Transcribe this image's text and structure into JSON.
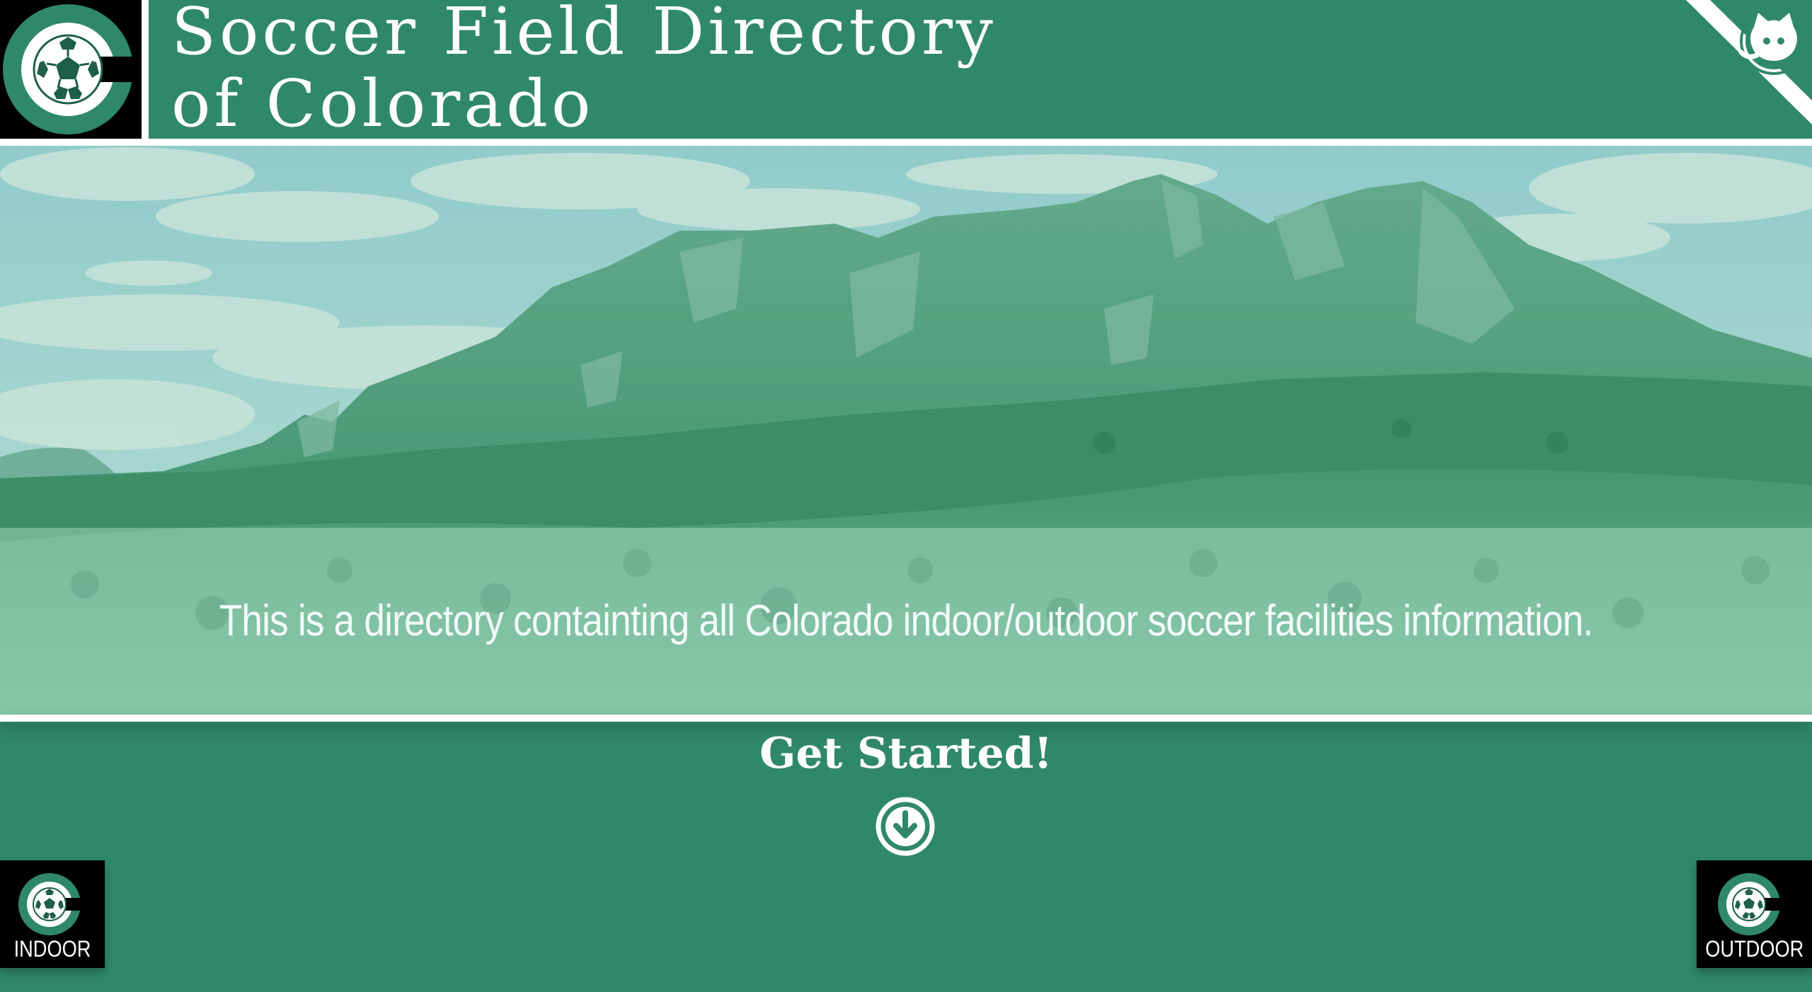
{
  "header": {
    "title_line1": "Soccer Field Directory",
    "title_line2": "of Colorado",
    "logo_icon": "colorado-soccer-logo-icon",
    "corner_icon": "github-octocat-icon"
  },
  "hero": {
    "tagline": "This is a directory containting all Colorado indoor/outdoor soccer facilities information."
  },
  "cta": {
    "label": "Get Started!",
    "icon": "arrow-down-circle-icon"
  },
  "corner_buttons": {
    "left": {
      "label": "INDOOR",
      "icon": "colorado-soccer-logo-icon"
    },
    "right": {
      "label": "OUTDOOR",
      "icon": "colorado-soccer-logo-icon"
    }
  },
  "colors": {
    "brand_green": "#30886b",
    "white": "#ffffff",
    "black": "#000000"
  }
}
